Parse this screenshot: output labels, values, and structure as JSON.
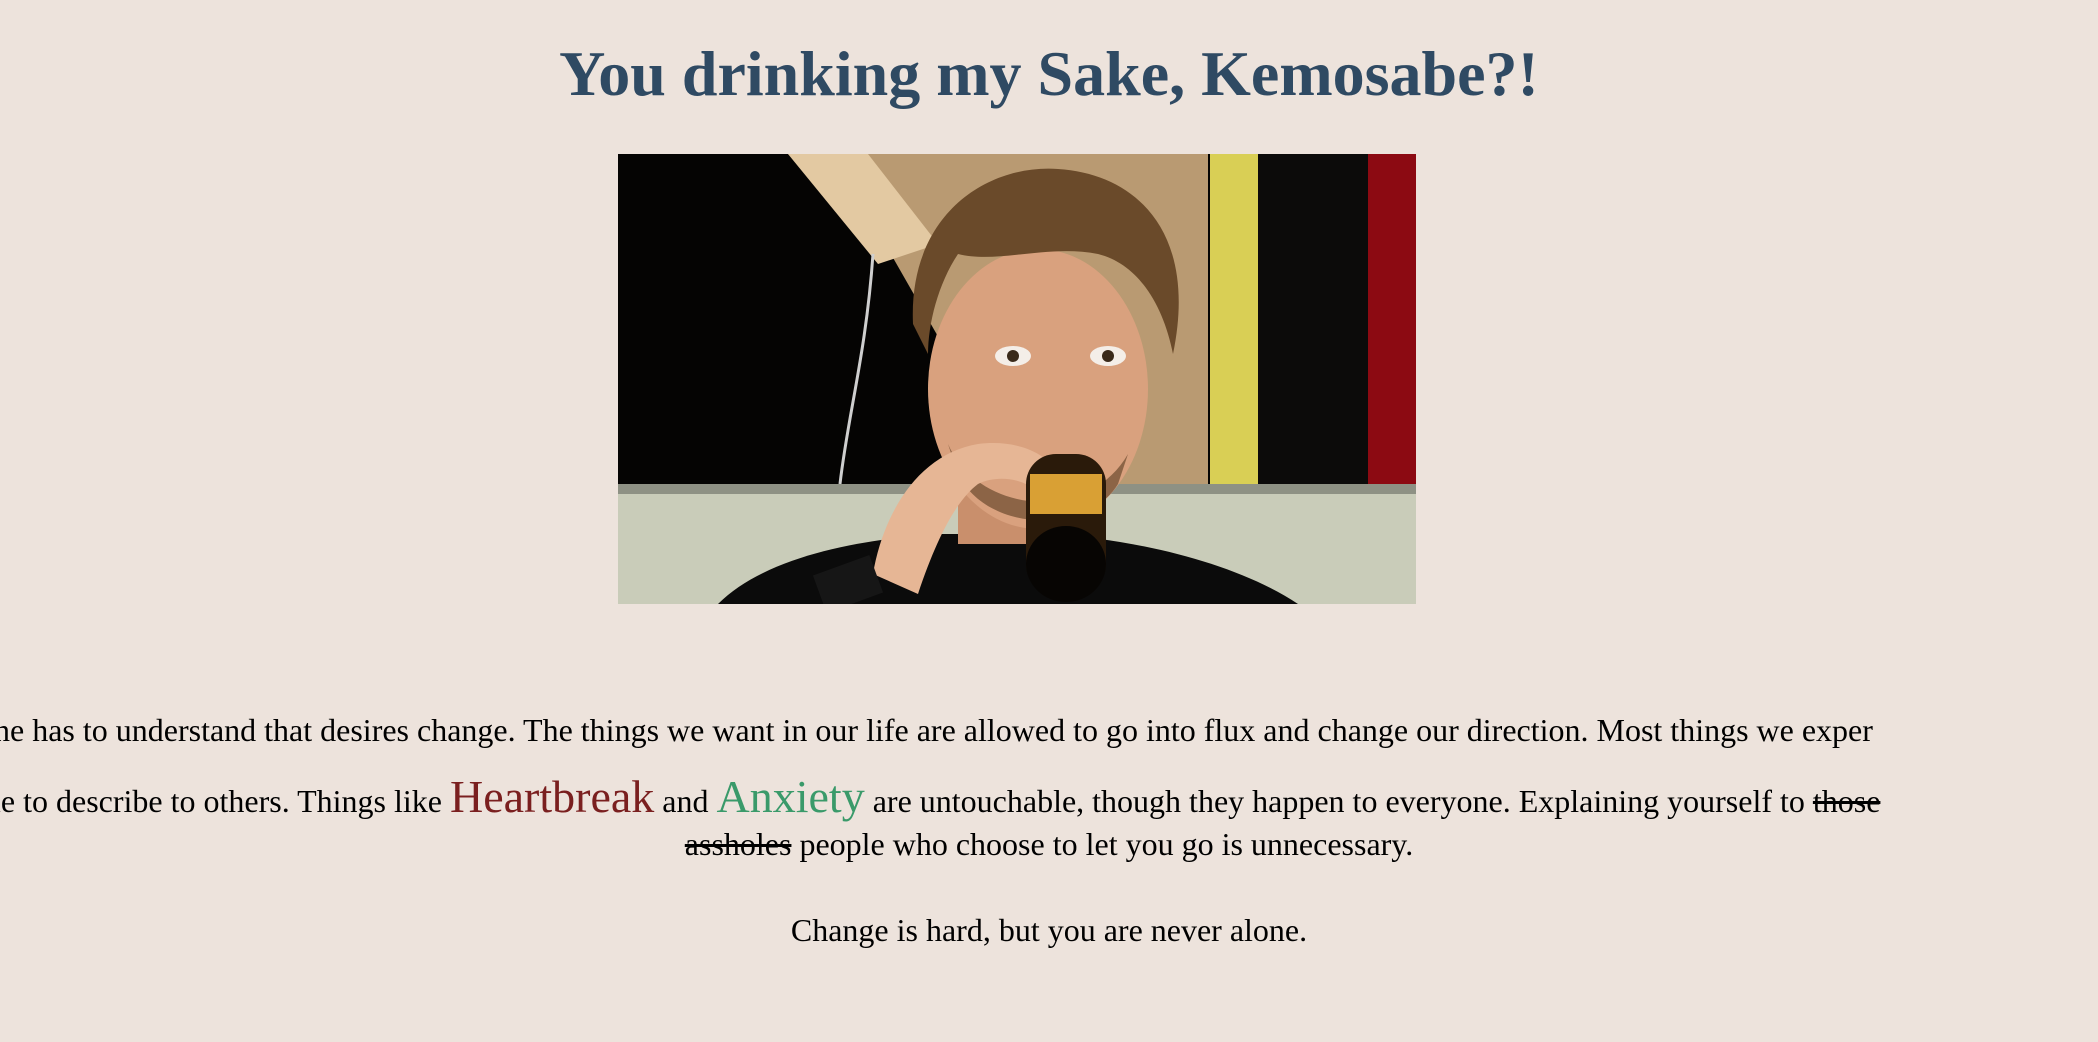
{
  "title": "You drinking my Sake, Kemosabe?!",
  "colors": {
    "background": "#ede3dc",
    "title": "#2f4a63",
    "heartbreak": "#7a1f1f",
    "anxiety": "#3a9a6a",
    "text": "#000000"
  },
  "image": {
    "alt": "man-drinking-from-bottle"
  },
  "paragraph": {
    "line1": "ne has to understand that desires change. The things we want in our life are allowed to go into flux and change our direction. Most things we exper",
    "line2_a": "le to describe to others. Things like ",
    "heartbreak": "Heartbreak",
    "line2_b": " and ",
    "anxiety": "Anxiety",
    "line2_c": " are untouchable, though they happen to everyone. Explaining yourself to ",
    "strike_1": "those ",
    "strike_2": "assholes",
    "line3_rest": " people who choose to let you go is unnecessary."
  },
  "closing": "Change is hard, but you are never alone."
}
